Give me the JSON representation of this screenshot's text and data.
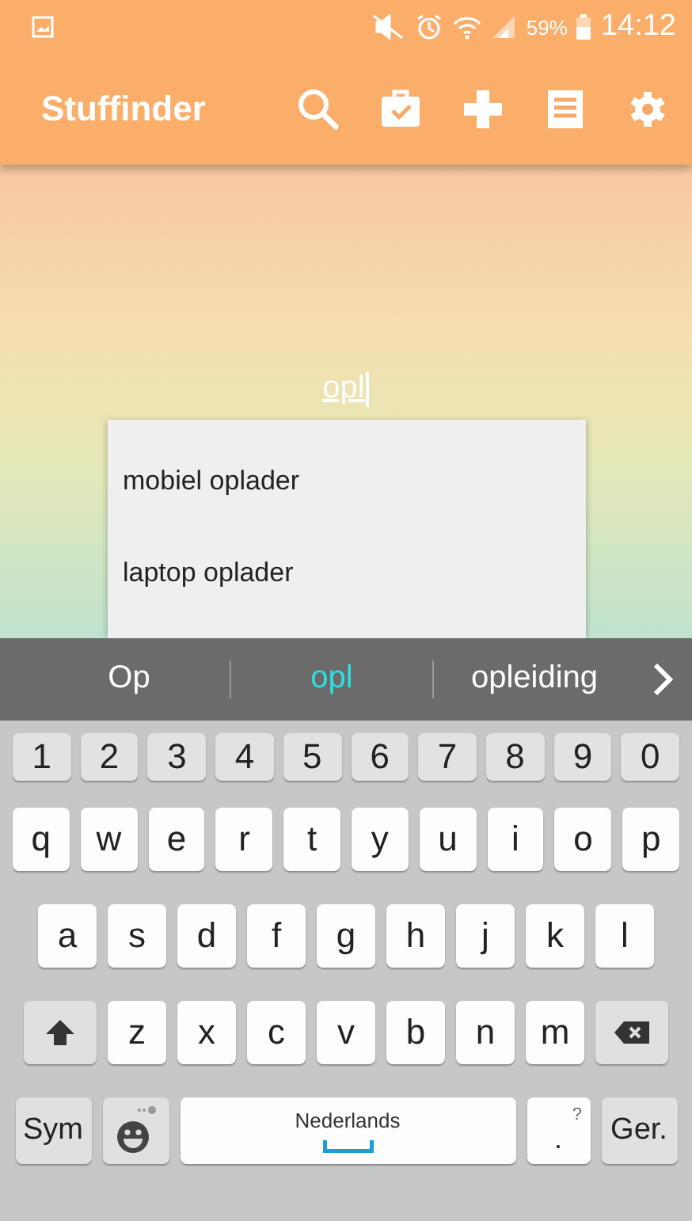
{
  "status_bar": {
    "battery": "59%",
    "time": "14:12"
  },
  "app_bar": {
    "title": "Stuffinder"
  },
  "search": {
    "value": "opl"
  },
  "autocomplete": [
    "mobiel oplader",
    "laptop oplader"
  ],
  "suggestions": [
    {
      "text": "Op",
      "selected": false
    },
    {
      "text": "opl",
      "selected": true
    },
    {
      "text": "opleiding",
      "selected": false
    }
  ],
  "keyboard": {
    "rows": [
      [
        {
          "kind": "digit",
          "label": "1"
        },
        {
          "kind": "digit",
          "label": "2"
        },
        {
          "kind": "digit",
          "label": "3"
        },
        {
          "kind": "digit",
          "label": "4"
        },
        {
          "kind": "digit",
          "label": "5"
        },
        {
          "kind": "digit",
          "label": "6"
        },
        {
          "kind": "digit",
          "label": "7"
        },
        {
          "kind": "digit",
          "label": "8"
        },
        {
          "kind": "digit",
          "label": "9"
        },
        {
          "kind": "digit",
          "label": "0"
        }
      ],
      [
        {
          "kind": "char",
          "label": "q"
        },
        {
          "kind": "char",
          "label": "w"
        },
        {
          "kind": "char",
          "label": "e"
        },
        {
          "kind": "char",
          "label": "r"
        },
        {
          "kind": "char",
          "label": "t"
        },
        {
          "kind": "char",
          "label": "y"
        },
        {
          "kind": "char",
          "label": "u"
        },
        {
          "kind": "char",
          "label": "i"
        },
        {
          "kind": "char",
          "label": "o"
        },
        {
          "kind": "char",
          "label": "p"
        }
      ],
      [
        {
          "kind": "char",
          "label": "a"
        },
        {
          "kind": "char",
          "label": "s"
        },
        {
          "kind": "char",
          "label": "d"
        },
        {
          "kind": "char",
          "label": "f"
        },
        {
          "kind": "char",
          "label": "g"
        },
        {
          "kind": "char",
          "label": "h"
        },
        {
          "kind": "char",
          "label": "j"
        },
        {
          "kind": "char",
          "label": "k"
        },
        {
          "kind": "char",
          "label": "l"
        }
      ],
      [
        {
          "kind": "shift"
        },
        {
          "kind": "char",
          "label": "z"
        },
        {
          "kind": "char",
          "label": "x"
        },
        {
          "kind": "char",
          "label": "c"
        },
        {
          "kind": "char",
          "label": "v"
        },
        {
          "kind": "char",
          "label": "b"
        },
        {
          "kind": "char",
          "label": "n"
        },
        {
          "kind": "char",
          "label": "m"
        },
        {
          "kind": "backspace"
        }
      ]
    ],
    "function_keys": {
      "sym": "Sym",
      "space": "Nederlands",
      "period": ".",
      "period_hint": "?",
      "enter": "Ger."
    }
  }
}
